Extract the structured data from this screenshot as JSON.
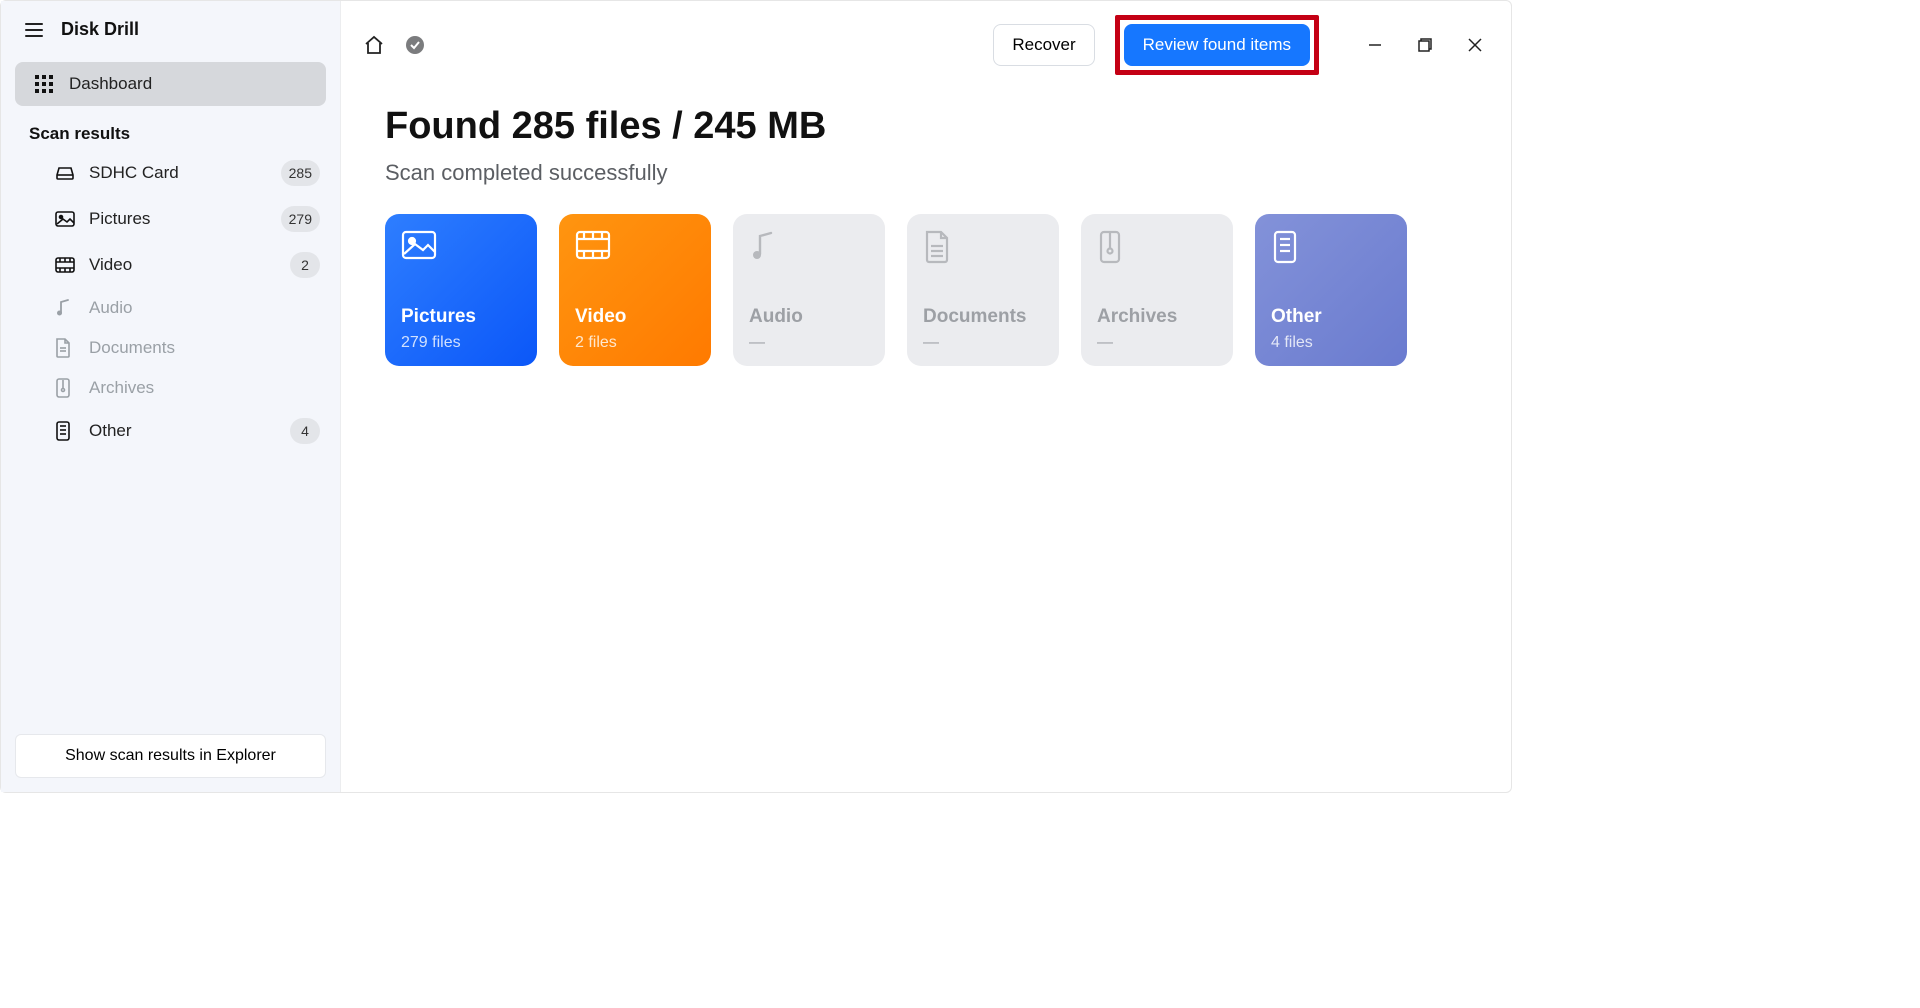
{
  "app_title": "Disk Drill",
  "sidebar": {
    "dashboard_label": "Dashboard",
    "section_label": "Scan results",
    "items": [
      {
        "label": "SDHC Card",
        "count": "285",
        "disabled": false
      },
      {
        "label": "Pictures",
        "count": "279",
        "disabled": false
      },
      {
        "label": "Video",
        "count": "2",
        "disabled": false
      },
      {
        "label": "Audio",
        "count": null,
        "disabled": true
      },
      {
        "label": "Documents",
        "count": null,
        "disabled": true
      },
      {
        "label": "Archives",
        "count": null,
        "disabled": true
      },
      {
        "label": "Other",
        "count": "4",
        "disabled": false
      }
    ],
    "footer_button": "Show scan results in Explorer"
  },
  "topbar": {
    "recover_label": "Recover",
    "review_label": "Review found items"
  },
  "headline": "Found 285 files / 245 MB",
  "subhead": "Scan completed successfully",
  "cards": [
    {
      "title": "Pictures",
      "sub": "279 files"
    },
    {
      "title": "Video",
      "sub": "2 files"
    },
    {
      "title": "Audio",
      "sub": "—"
    },
    {
      "title": "Documents",
      "sub": "—"
    },
    {
      "title": "Archives",
      "sub": "—"
    },
    {
      "title": "Other",
      "sub": "4 files"
    }
  ]
}
